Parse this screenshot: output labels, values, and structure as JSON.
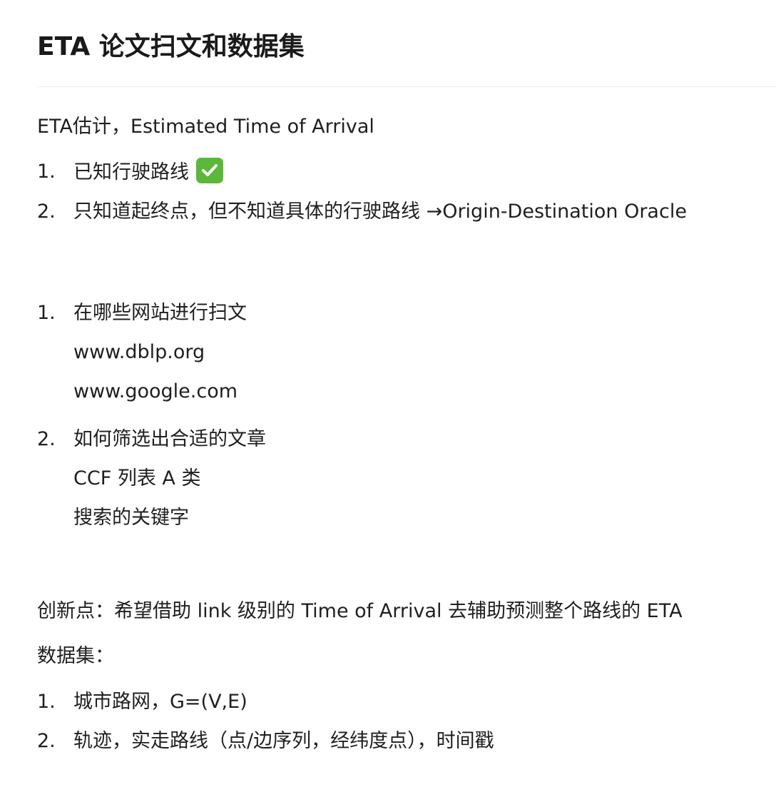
{
  "title": "ETA 论文扫文和数据集",
  "intro": "ETA估计，Estimated Time of Arrival",
  "list1": [
    {
      "num": "1.",
      "text": "已知行驶路线"
    },
    {
      "num": "2.",
      "text": "只知道起终点，但不知道具体的行驶路线 →Origin-Destination Oracle"
    }
  ],
  "list2": [
    {
      "num": "1.",
      "text": "在哪些网站进行扫文",
      "sub": [
        "www.dblp.org",
        "www.google.com"
      ]
    },
    {
      "num": "2.",
      "text": "如何筛选出合适的文章",
      "sub": [
        "CCF 列表 A 类",
        "搜索的关键字"
      ]
    }
  ],
  "innovation": "创新点：希望借助 link 级别的 Time of Arrival 去辅助预测整个路线的 ETA",
  "dataset_label": "数据集：",
  "list3": [
    {
      "num": "1.",
      "text": "城市路网，G=(V,E)"
    },
    {
      "num": "2.",
      "text": "轨迹，实走路线（点/边序列，经纬度点），时间戳"
    }
  ],
  "colors": {
    "check_green": "#5cb83b",
    "rule": "#ececec",
    "text": "#1f1f1f"
  }
}
